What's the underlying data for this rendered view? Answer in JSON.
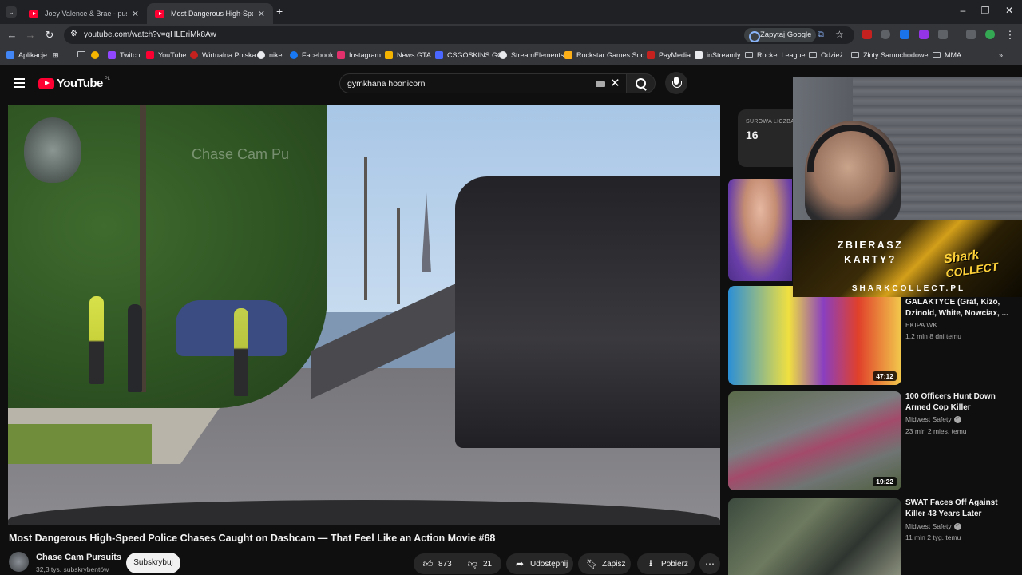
{
  "browser": {
    "tabs": [
      {
        "title": "Joey Valence & Brae - push the"
      },
      {
        "title": "Most Dangerous High-Speed P"
      }
    ],
    "url": "youtube.com/watch?v=qHLEriMk8Aw",
    "ask_google": "Zapytaj Google",
    "bookmarks": [
      "Aplikacje",
      "Twitch",
      "YouTube",
      "Wirtualna Polska",
      "nike",
      "Facebook",
      "Instagram",
      "News GTA",
      "CSGOSKINS.GG",
      "StreamElements",
      "Rockstar Games Soc...",
      "PayMedia",
      "inStreamly",
      "Rocket League",
      "Odzież",
      "Złoty Samochodowe",
      "MMA"
    ]
  },
  "youtube": {
    "logo": "YouTube",
    "country": "PL",
    "search_value": "gymkhana hoonicorn",
    "video": {
      "watermark": "Chase Cam Pu",
      "title": "Most Dangerous High-Speed Police Chases Caught on Dashcam — That Feel Like an Action Movie #68",
      "channel": "Chase Cam Pursuits",
      "subscribers": "32,3 tys. subskrybentów",
      "subscribe": "Subskrybuj",
      "likes": "873",
      "dislikes": "21",
      "share": "Udostępnij",
      "save": "Zapisz",
      "download": "Pobierz"
    },
    "raw_card": {
      "label": "SUROWA LICZBA",
      "value": "16"
    },
    "recommended": [
      {
        "title": "GALAKTYCE (Graf, Kizo, Dzinold, White, Nowciax, ...",
        "channel": "EKIPA WK",
        "meta": "1,2 mln  8 dni temu",
        "duration": "47:12",
        "verified": false
      },
      {
        "title": "100 Officers Hunt Down Armed Cop Killer",
        "channel": "Midwest Safety",
        "meta": "23 mln  2 mies. temu",
        "duration": "19:22",
        "verified": true
      },
      {
        "title": "SWAT Faces Off Against Killer 43 Years Later",
        "channel": "Midwest Safety",
        "meta": "11 mln  2 tyg. temu",
        "duration": "",
        "verified": true
      }
    ]
  },
  "overlay": {
    "ad_line1": "ZBIERASZ",
    "ad_line2": "KARTY?",
    "ad_brand1": "Shark",
    "ad_brand2": "COLLECT",
    "ad_url": "SHARKCOLLECT.PL"
  },
  "colors": {
    "yt_red": "#ff0033",
    "bg": "#0f0f0f",
    "chrome_dark": "#202124",
    "chrome_toolbar": "#35363a"
  }
}
